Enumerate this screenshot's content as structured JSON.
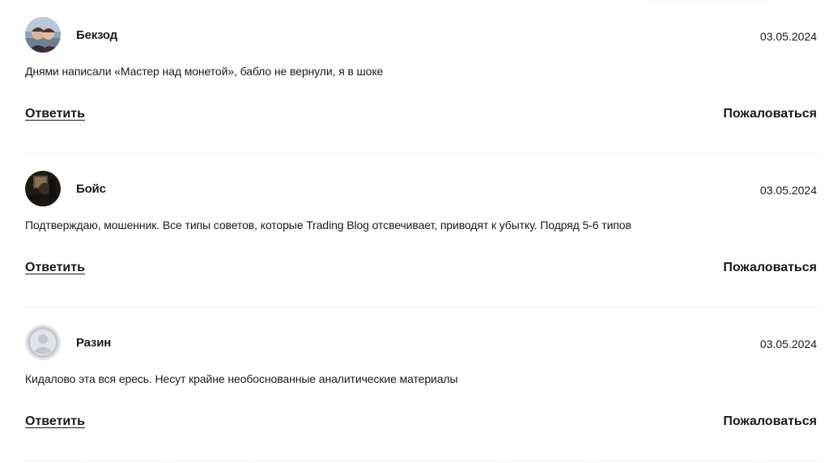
{
  "comments": [
    {
      "author": "Бекзод",
      "date": "03.05.2024",
      "text": "Днями написали «Мастер над монетой», бабло не вернули, я в шоке",
      "avatar": "photo-avatar",
      "reply_label": "Ответить",
      "complain_label": "Пожаловаться"
    },
    {
      "author": "Бойс",
      "date": "03.05.2024",
      "text": "Подтверждаю, мошенник. Все типы советов, которые Trading Blog отсвечивает, приводят к убытку. Подряд 5-6 типов",
      "avatar": "photo-avatar",
      "reply_label": "Ответить",
      "complain_label": "Пожаловаться"
    },
    {
      "author": "Разин",
      "date": "03.05.2024",
      "text": "Кидалово эта вся ересь. Несут крайне необоснованные аналитические материалы",
      "avatar": "default-user-icon",
      "reply_label": "Ответить",
      "complain_label": "Пожаловаться"
    }
  ],
  "colors": {
    "text": "#1a1a1a",
    "divider": "#e4e4e4",
    "default_avatar_bg": "#e2e4e8",
    "default_avatar_fg": "#b9bec6"
  }
}
